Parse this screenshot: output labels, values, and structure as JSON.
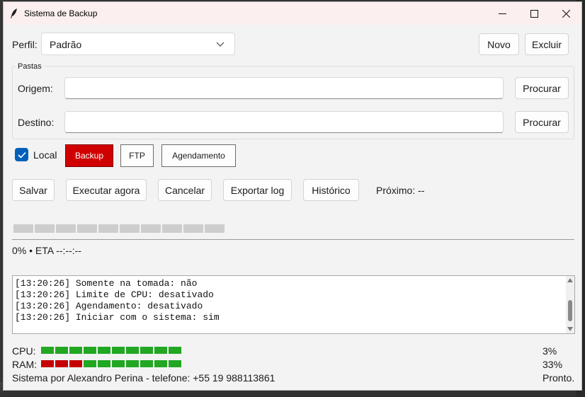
{
  "window": {
    "title": "Sistema de Backup"
  },
  "profile": {
    "label": "Perfil:",
    "selected": "Padrão",
    "new_label": "Novo",
    "delete_label": "Excluir"
  },
  "folders": {
    "group_title": "Pastas",
    "origin_label": "Origem:",
    "origin_value": "",
    "destination_label": "Destino:",
    "destination_value": "",
    "browse_label": "Procurar"
  },
  "modes": {
    "local_label": "Local",
    "local_checked": true,
    "backup_label": "Backup",
    "ftp_label": "FTP",
    "schedule_label": "Agendamento"
  },
  "actions": {
    "save": "Salvar",
    "run_now": "Executar agora",
    "cancel": "Cancelar",
    "export_log": "Exportar log",
    "history": "Histórico",
    "next_run": "Próximo: --"
  },
  "progress": {
    "fraction": 0,
    "segments": 10,
    "text": "0% • ETA --:--:--"
  },
  "log": {
    "lines": [
      "[13:20:26] Somente na tomada: não",
      "[13:20:26] Limite de CPU: desativado",
      "[13:20:26] Agendamento: desativado",
      "[13:20:26] Iniciar com o sistema: sim"
    ]
  },
  "meters": {
    "cpu_label": "CPU:",
    "cpu_value": "3%",
    "cpu_states": [
      "g",
      "g",
      "g",
      "g",
      "g",
      "g",
      "g",
      "g",
      "g",
      "g"
    ],
    "ram_label": "RAM:",
    "ram_value": "33%",
    "ram_states": [
      "r",
      "r",
      "r",
      "g",
      "g",
      "g",
      "g",
      "g",
      "g",
      "g"
    ]
  },
  "footer": {
    "credits": "Sistema por Alexandro Perina - telefone: +55 19 988113861",
    "status": "Pronto."
  },
  "colors": {
    "accent": "#005fb8",
    "active_mode": "#d10000",
    "meter_green": "#22a722",
    "meter_red": "#c40000",
    "progress_empty": "#cdcdcd"
  }
}
